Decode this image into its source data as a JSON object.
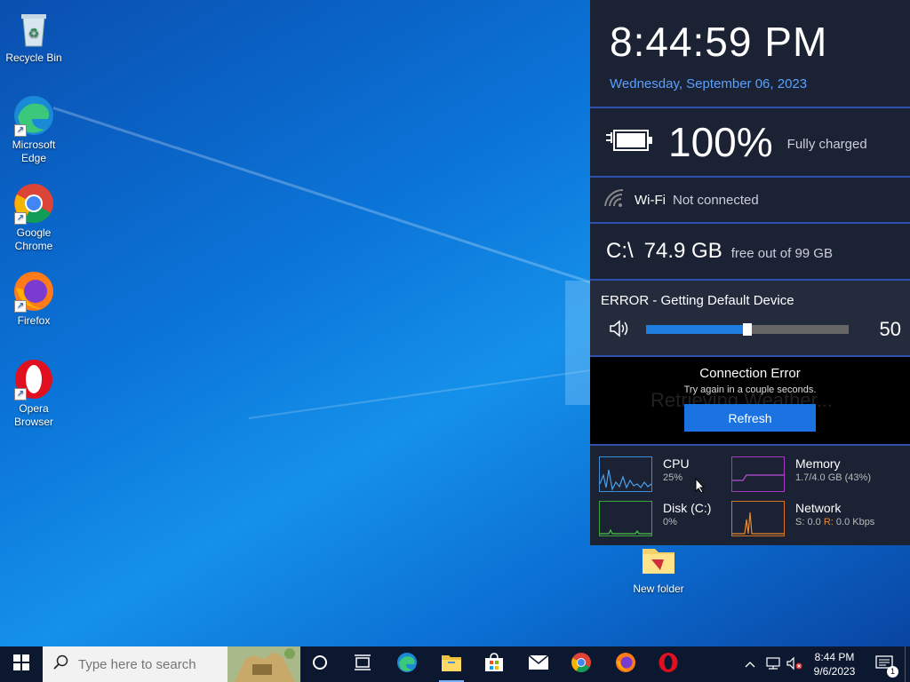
{
  "desktop": {
    "icons": [
      {
        "label": "Recycle Bin",
        "icon": "recycle-bin-icon"
      },
      {
        "label": "Microsoft Edge",
        "icon": "edge-icon"
      },
      {
        "label": "Google Chrome",
        "icon": "chrome-icon"
      },
      {
        "label": "Firefox",
        "icon": "firefox-icon"
      },
      {
        "label": "Opera Browser",
        "icon": "opera-icon"
      },
      {
        "label": "New folder",
        "icon": "folder-icon"
      }
    ]
  },
  "widget": {
    "time": "8:44:59 PM",
    "date": "Wednesday, September 06, 2023",
    "battery": {
      "percent": "100%",
      "status": "Fully charged",
      "level": 1.0
    },
    "wifi": {
      "label": "Wi-Fi",
      "status": "Not connected"
    },
    "disk": {
      "drive": "C:\\",
      "free": "74.9 GB",
      "detail": "free out of 99 GB"
    },
    "volume": {
      "title": "ERROR - Getting Default Device",
      "value": "50",
      "level": 0.5
    },
    "weather": {
      "title": "Connection Error",
      "subtitle": "Try again in a couple seconds.",
      "refresh_label": "Refresh",
      "ghost_text": "Retrieving Weather..."
    },
    "monitors": {
      "cpu": {
        "name": "CPU",
        "value": "25%",
        "color": "#3a8fd8"
      },
      "memory": {
        "name": "Memory",
        "value": "1.7/4.0 GB (43%)",
        "color": "#a33ac0"
      },
      "disk": {
        "name": "Disk (C:)",
        "value": "0%",
        "color": "#3aa83a"
      },
      "network": {
        "name": "Network",
        "send_label": "S:",
        "send": "0.0",
        "recv_label": "R:",
        "recv": "0.0 Kbps",
        "color": "#d8761f"
      }
    }
  },
  "taskbar": {
    "search_placeholder": "Type here to search",
    "apps": [
      "cortana-icon",
      "task-view-icon",
      "edge-icon",
      "file-explorer-icon",
      "store-icon",
      "mail-icon",
      "chrome-icon",
      "firefox-icon",
      "opera-icon"
    ],
    "clock_time": "8:44 PM",
    "clock_date": "9/6/2023",
    "notification_count": "1"
  },
  "colors": {
    "accent": "#1a73e0",
    "panel_bg": "#1b2233",
    "date_blue": "#5aa0ff"
  }
}
